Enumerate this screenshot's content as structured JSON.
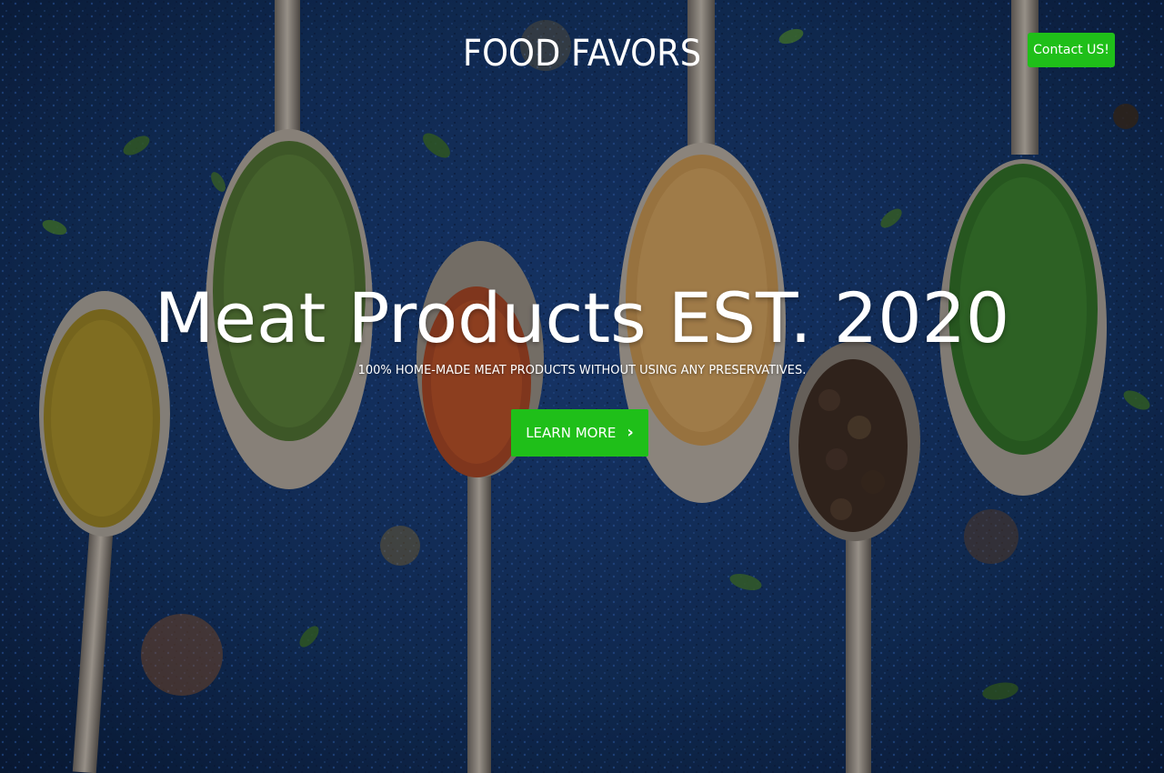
{
  "header": {
    "brand": "FOOD FAVORS",
    "contact_label": "Contact US!"
  },
  "hero": {
    "headline": "Meat Products EST. 2020",
    "subheadline": "100% HOME-MADE MEAT PRODUCTS WITHOUT USING ANY PRESERVATIVES.",
    "cta_label": "LEARN MORE",
    "cta_icon": "chevron-right-icon",
    "chevron_glyph": "›"
  },
  "colors": {
    "accent": "#1fbf19",
    "background": "#0d2550",
    "text": "#ffffff"
  }
}
